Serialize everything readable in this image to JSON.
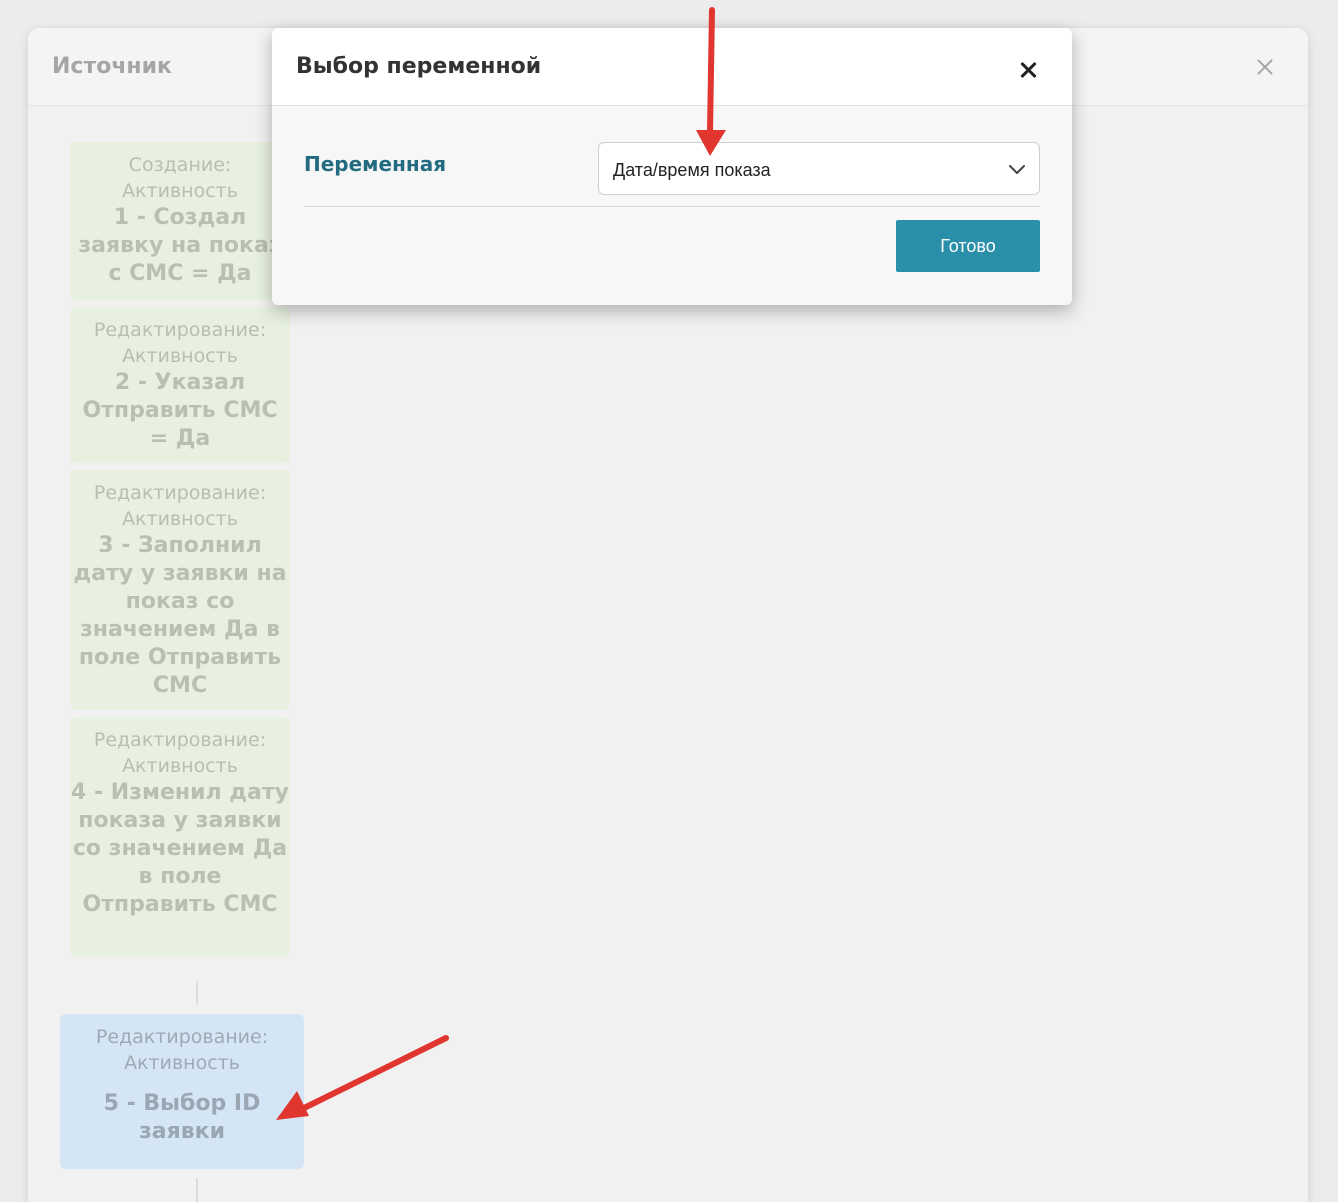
{
  "background_dialog": {
    "title": "Источник",
    "steps": [
      {
        "category": "Создание:",
        "type": "Активность",
        "name": "1 - Создал заявку на показ с СМС = Да"
      },
      {
        "category": "Редактирование:",
        "type": "Активность",
        "name": "2 - Указал Отправить СМС = Да"
      },
      {
        "category": "Редактирование:",
        "type": "Активность",
        "name": "3 - Заполнил дату у заявки на показ со значением Да в поле Отправить СМС"
      },
      {
        "category": "Редактирование:",
        "type": "Активность",
        "name": "4 - Изменил дату показа у заявки со значением Да в поле Отправить СМС"
      },
      {
        "category": "Редактирование:",
        "type": "Активность",
        "name": "5 - Выбор ID заявки"
      }
    ]
  },
  "modal": {
    "title": "Выбор переменной",
    "field_label": "Переменная",
    "select_value": "Дата/время показа",
    "done_label": "Готово"
  },
  "colors": {
    "accent": "#2a8fa8",
    "label": "#236b80",
    "step_green": "#e8f1df",
    "step_blue": "#d4e6f6",
    "annotation_arrow": "#e0362f"
  }
}
